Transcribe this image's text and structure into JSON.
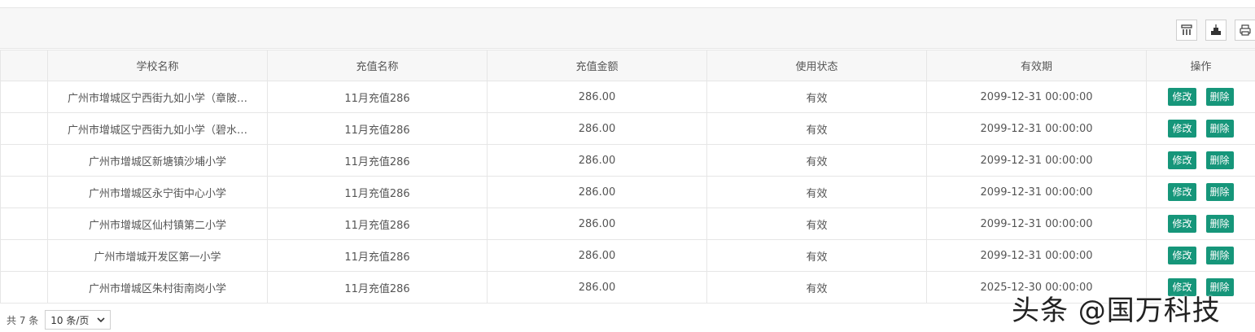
{
  "toolbar": {
    "icons": [
      "columns-icon",
      "export-icon",
      "print-icon"
    ]
  },
  "table": {
    "headers": [
      "学校名称",
      "充值名称",
      "充值金额",
      "使用状态",
      "有效期",
      "操作"
    ],
    "rows": [
      {
        "school": "广州市增城区宁西街九如小学（章陂…",
        "name": "11月充值286",
        "amount": "286.00",
        "status": "有效",
        "expiry": "2099-12-31 00:00:00"
      },
      {
        "school": "广州市增城区宁西街九如小学（碧水…",
        "name": "11月充值286",
        "amount": "286.00",
        "status": "有效",
        "expiry": "2099-12-31 00:00:00"
      },
      {
        "school": "广州市增城区新塘镇沙埔小学",
        "name": "11月充值286",
        "amount": "286.00",
        "status": "有效",
        "expiry": "2099-12-31 00:00:00"
      },
      {
        "school": "广州市增城区永宁街中心小学",
        "name": "11月充值286",
        "amount": "286.00",
        "status": "有效",
        "expiry": "2099-12-31 00:00:00"
      },
      {
        "school": "广州市增城区仙村镇第二小学",
        "name": "11月充值286",
        "amount": "286.00",
        "status": "有效",
        "expiry": "2099-12-31 00:00:00"
      },
      {
        "school": "广州市增城开发区第一小学",
        "name": "11月充值286",
        "amount": "286.00",
        "status": "有效",
        "expiry": "2099-12-31 00:00:00"
      },
      {
        "school": "广州市增城区朱村街南岗小学",
        "name": "11月充值286",
        "amount": "286.00",
        "status": "有效",
        "expiry": "2025-12-30 00:00:00"
      }
    ],
    "edit_label": "修改",
    "delete_label": "删除"
  },
  "pager": {
    "total": "共 7 条",
    "page_size": "10 条/页"
  },
  "watermark": "头条 @国万科技",
  "colors": {
    "action_button": "#16967a",
    "header_bg": "#f7f7f7",
    "border": "#e6e6e6"
  }
}
